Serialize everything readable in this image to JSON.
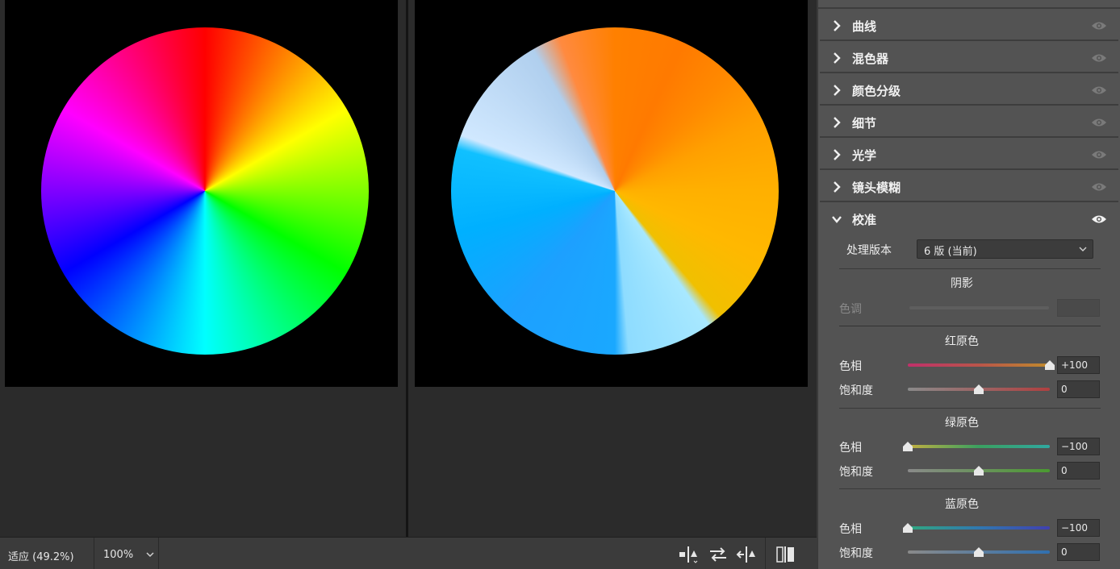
{
  "canvas": {
    "left_image": "original color wheel",
    "right_image": "calibrated color wheel"
  },
  "statusbar": {
    "fit": "适应 (49.2%)",
    "zoom": "100%"
  },
  "panel": {
    "sections": [
      {
        "label": "曲线",
        "expanded": false
      },
      {
        "label": "混色器",
        "expanded": false
      },
      {
        "label": "颜色分级",
        "expanded": false
      },
      {
        "label": "细节",
        "expanded": false
      },
      {
        "label": "光学",
        "expanded": false
      },
      {
        "label": "镜头模糊",
        "expanded": false
      },
      {
        "label": "校准",
        "expanded": true
      }
    ],
    "calibration": {
      "process_label": "处理版本",
      "process_value": "6 版 (当前)",
      "shadows": {
        "title": "阴影",
        "tint_label": "色调",
        "tint_value": ""
      },
      "red": {
        "title": "红原色",
        "hue_label": "色相",
        "hue_value": "+100",
        "hue_level": 100,
        "sat_label": "饱和度",
        "sat_value": "0",
        "sat_level": 0
      },
      "green": {
        "title": "绿原色",
        "hue_label": "色相",
        "hue_value": "−100",
        "hue_level": -100,
        "sat_label": "饱和度",
        "sat_value": "0",
        "sat_level": 0
      },
      "blue": {
        "title": "蓝原色",
        "hue_label": "色相",
        "hue_value": "−100",
        "hue_level": -100,
        "sat_label": "饱和度",
        "sat_value": "0",
        "sat_level": 0
      }
    }
  },
  "colors": {
    "panel_bg": "#535353",
    "canvas_bg": "#2b2b2b",
    "image_bg": "#000000"
  }
}
